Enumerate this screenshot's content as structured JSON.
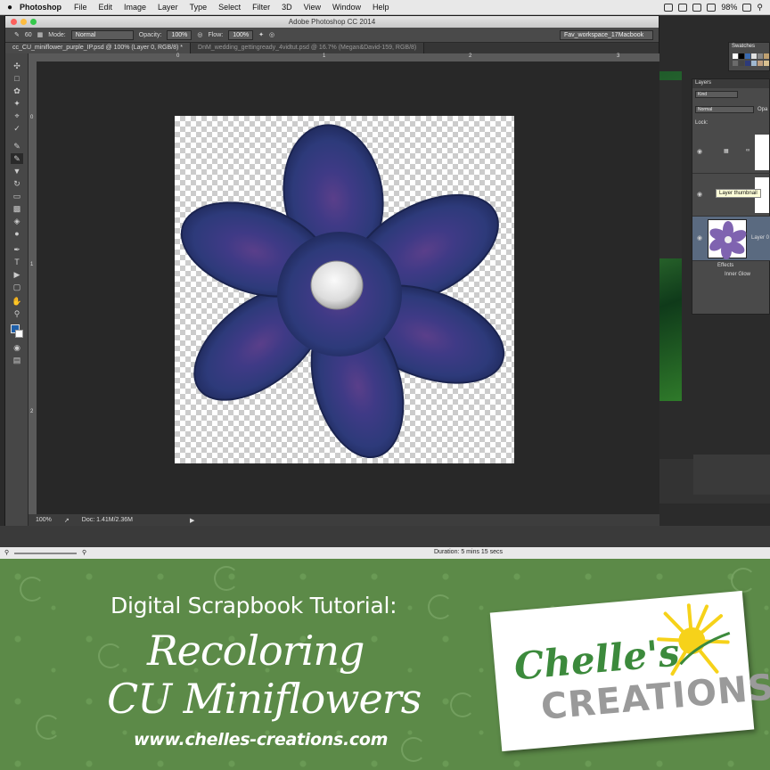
{
  "menubar": {
    "app": "Photoshop",
    "items": [
      "File",
      "Edit",
      "Image",
      "Layer",
      "Type",
      "Select",
      "Filter",
      "3D",
      "View",
      "Window",
      "Help"
    ],
    "battery": "98%"
  },
  "window": {
    "title": "Adobe Photoshop CC 2014"
  },
  "options": {
    "brush_size": "60",
    "mode_label": "Mode:",
    "mode_value": "Normal",
    "opacity_label": "Opacity:",
    "opacity_value": "100%",
    "flow_label": "Flow:",
    "flow_value": "100%",
    "workspace": "Fav_workspace_17Macbook"
  },
  "tabs": [
    {
      "label": "cc_CU_miniflower_purple_IP.psd @ 100% (Layer 0, RGB/8) *"
    },
    {
      "label": "DnM_wedding_gettingready_4vidtut.psd @ 16.7% (Megan&David-159, RGB/8)"
    }
  ],
  "ruler": {
    "top": [
      "0",
      "1",
      "2",
      "3"
    ],
    "left": [
      "0",
      "1",
      "2"
    ]
  },
  "status": {
    "zoom": "100%",
    "doc": "Doc: 1.41M/2.36M"
  },
  "panels": {
    "swatches_title": "Swatches",
    "layers_title": "Layers",
    "kind": "Kind",
    "blend": "Normal",
    "opacity_short": "Opa",
    "lock": "Lock:",
    "tooltip": "Layer thumbnail",
    "layer_name": "Layer 0",
    "effects": "Effects",
    "inner_glow": "Inner Glow"
  },
  "bottom": {
    "duration": "Duration: 5 mins 15 secs"
  },
  "banner": {
    "subtitle": "Digital Scrapbook Tutorial:",
    "title_line1": "Recoloring",
    "title_line2": "CU Miniflowers",
    "url": "www.chelles-creations.com",
    "logo_top": "Chelle's",
    "logo_bottom": "CREATIONS",
    "colors": {
      "green": "#5c8a48",
      "flower_blue": "#2d3a7a",
      "logo_green": "#3c8a3c",
      "sun_yellow": "#f6d21a"
    }
  }
}
